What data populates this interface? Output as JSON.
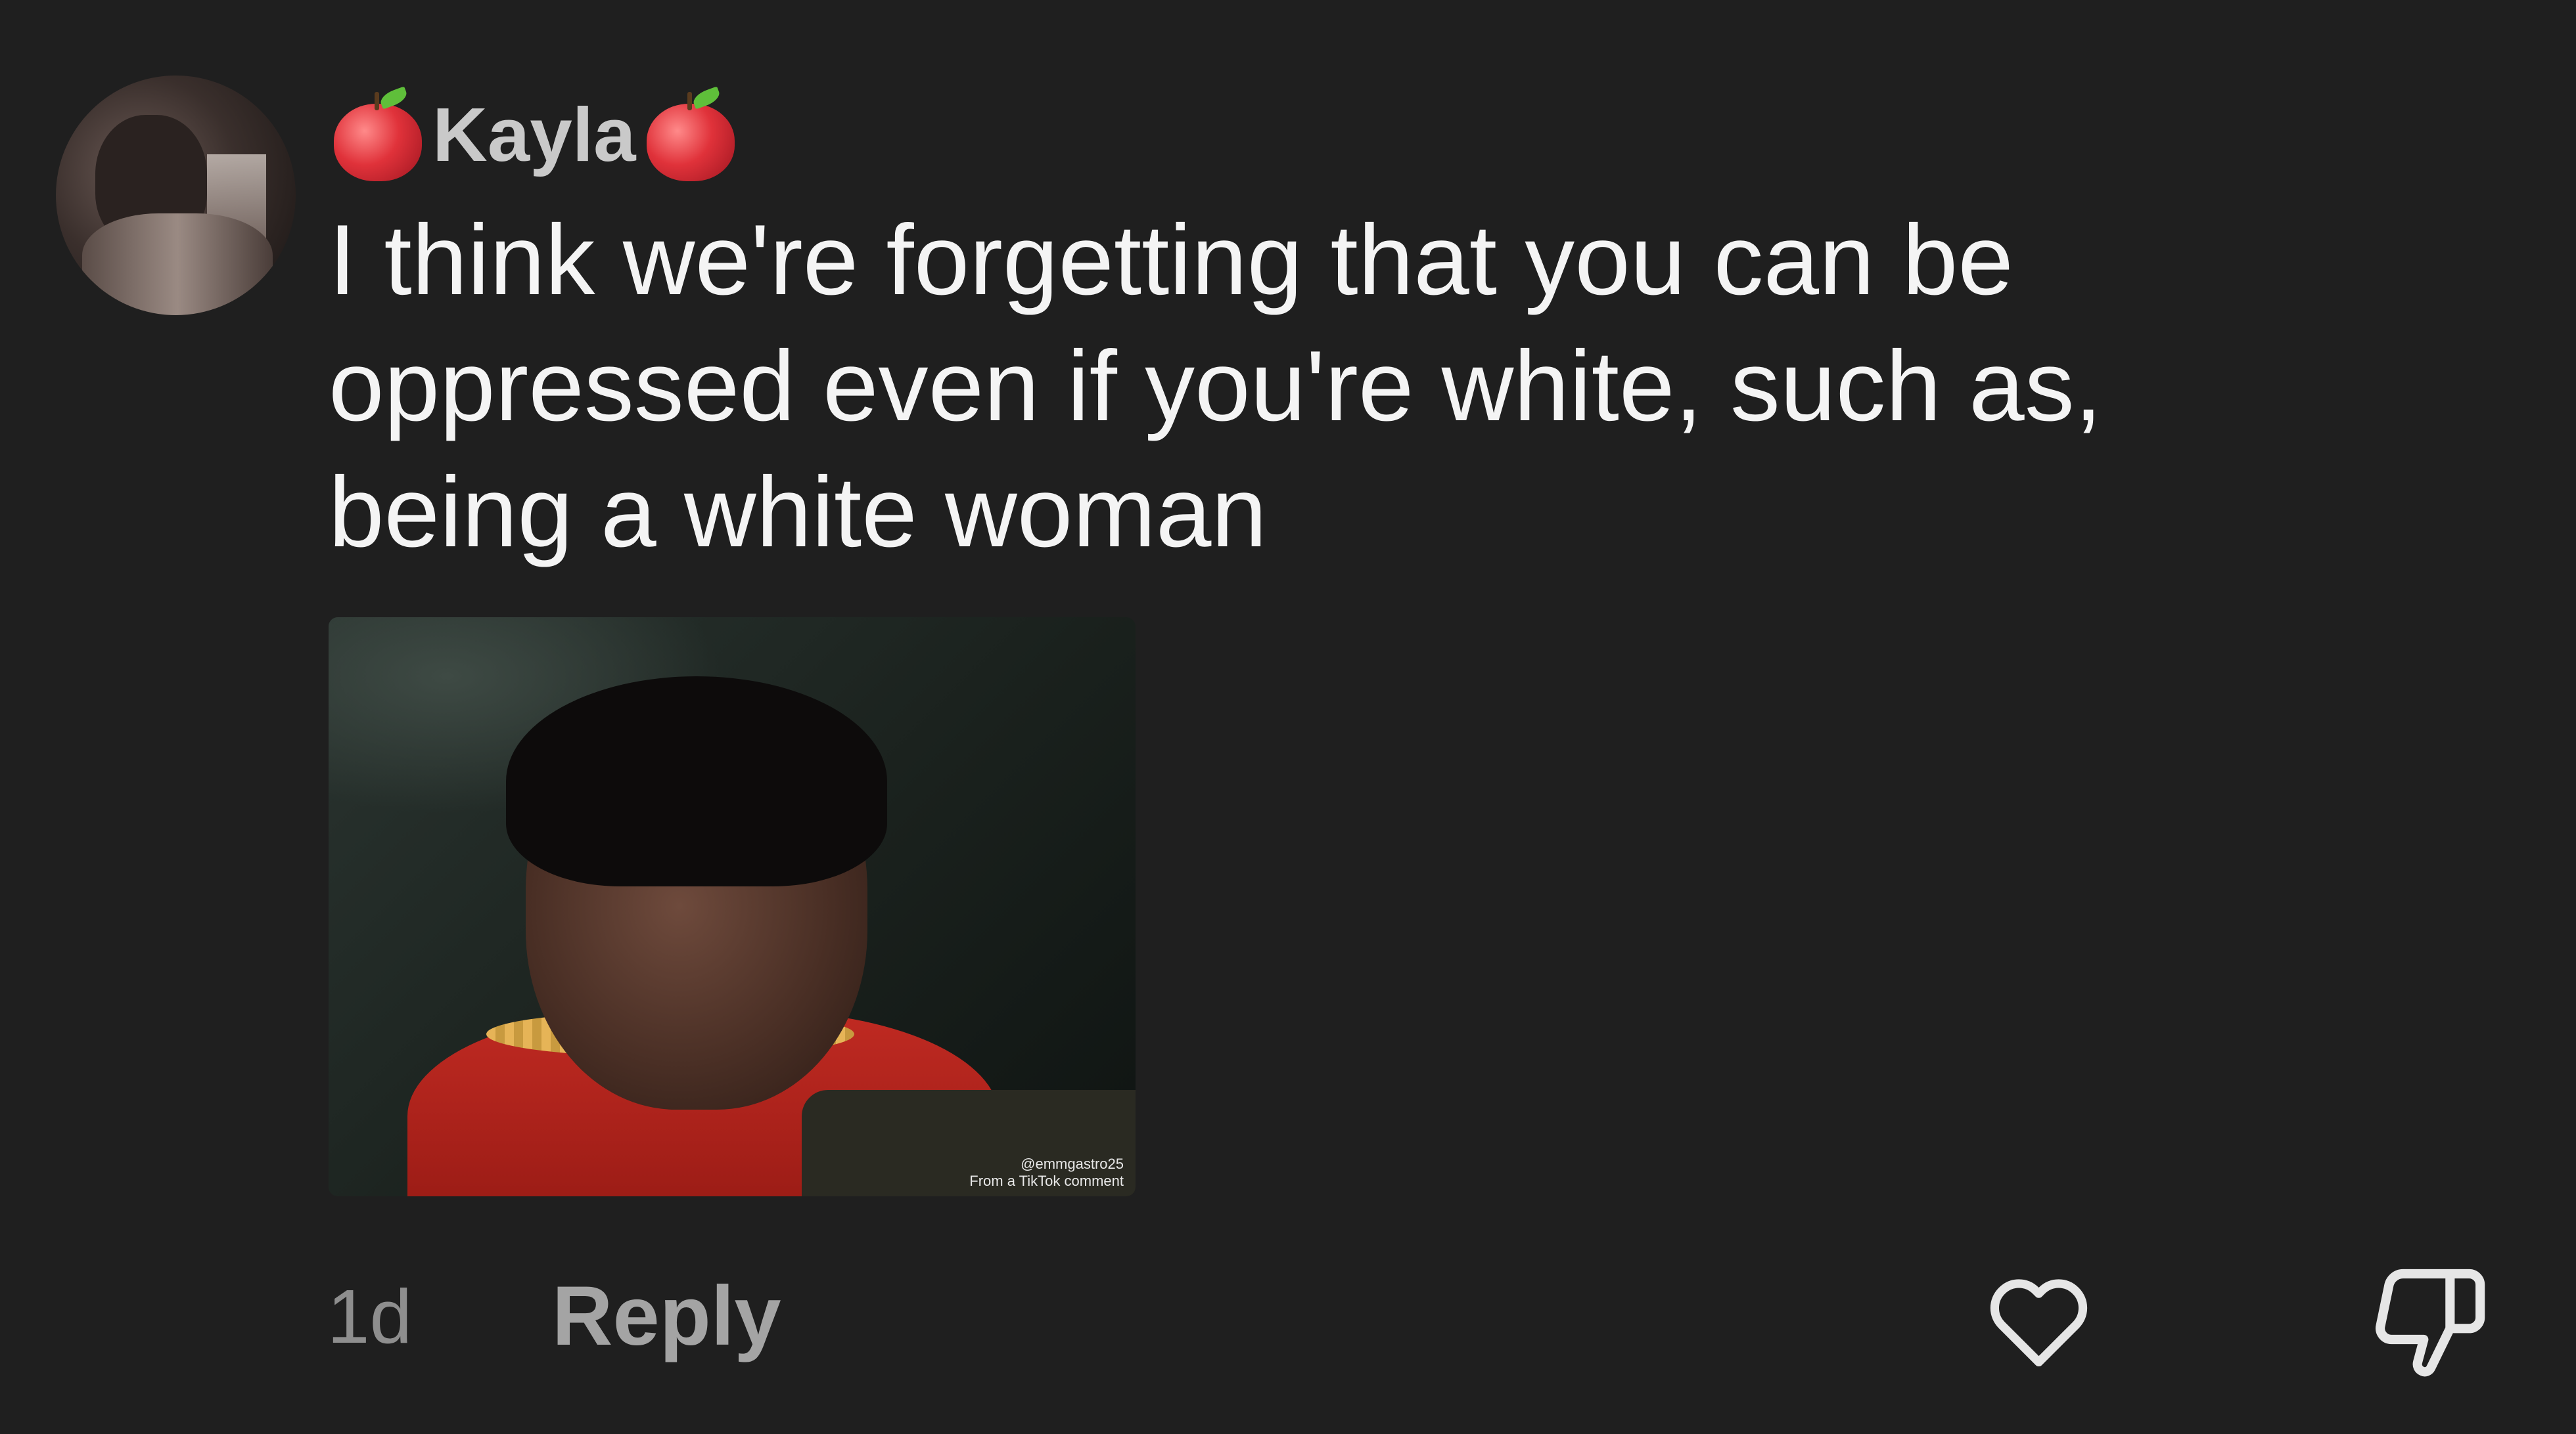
{
  "comment": {
    "username": "Kayla",
    "username_emoji_icon": "red-apple-icon",
    "text": "I think we're forgetting that you can be\noppressed even if you're white, such as,\nbeing a white woman",
    "gif_watermark_line1": "@emmgastro25",
    "gif_watermark_line2": "From a TikTok comment",
    "time": "1d",
    "reply_label": "Reply",
    "like_icon": "heart-outline-icon",
    "dislike_icon": "thumbs-down-outline-icon"
  },
  "colors": {
    "background": "#1f1f1f",
    "text": "#f4f4f4",
    "username": "#c9c9c9",
    "muted": "#8e8e8e"
  }
}
